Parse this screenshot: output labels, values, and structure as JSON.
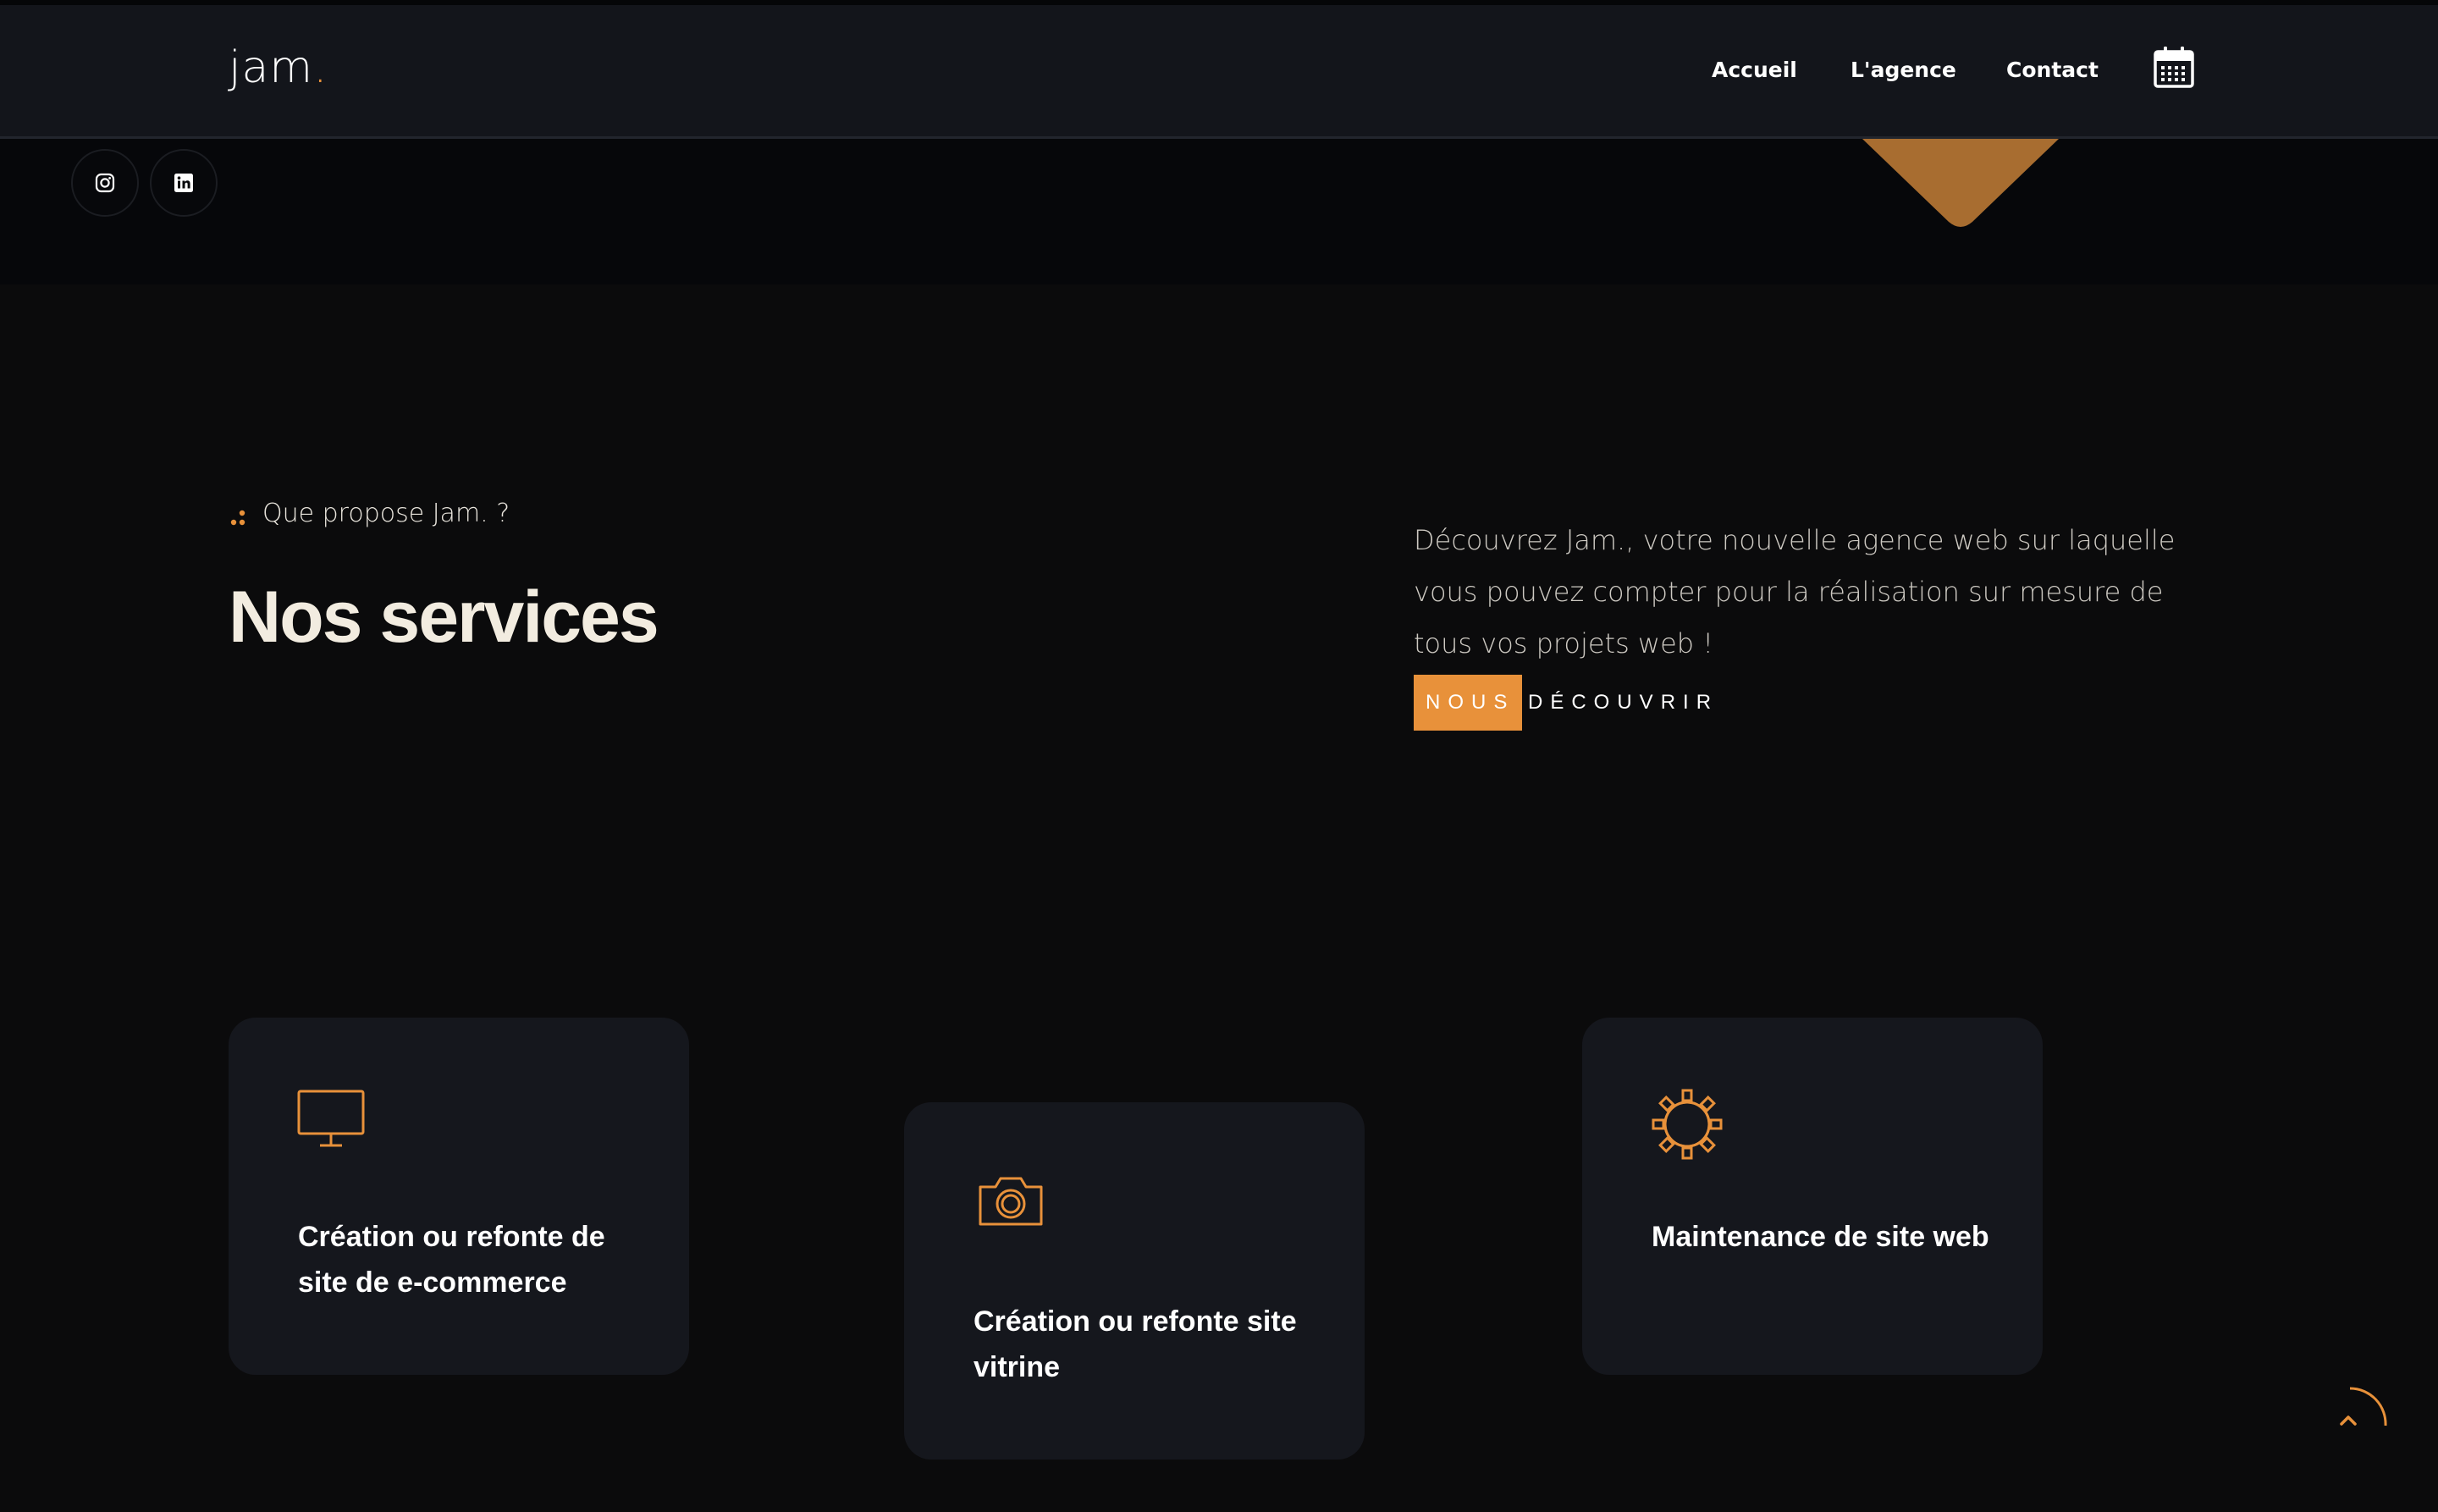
{
  "header": {
    "logo_text": "jam",
    "logo_dot": ".",
    "nav": [
      "Accueil",
      "L'agence",
      "Contact"
    ],
    "calendar_icon": "calendar-icon"
  },
  "social": [
    "instagram-icon",
    "linkedin-icon"
  ],
  "services": {
    "eyebrow": "Que propose Jam. ?",
    "title": "Nos services",
    "intro": "Découvrez Jam., votre nouvelle agence web sur laquelle vous pouvez compter pour la réalisation sur mesure de tous vos projets web !",
    "cta_label": "NOUS DÉCOUVRIR",
    "cards": [
      {
        "icon": "monitor-icon",
        "title": "Création ou refonte de site de e-commerce"
      },
      {
        "icon": "camera-icon",
        "title": "Création ou refonte site vitrine"
      },
      {
        "icon": "gear-icon",
        "title": "Maintenance de site web"
      }
    ]
  },
  "colors": {
    "accent": "#e8913a",
    "background": "#0b0b0c",
    "navbar": "#13151b",
    "card": "#15171d"
  },
  "scroll_top_icon": "chevron-up-icon"
}
